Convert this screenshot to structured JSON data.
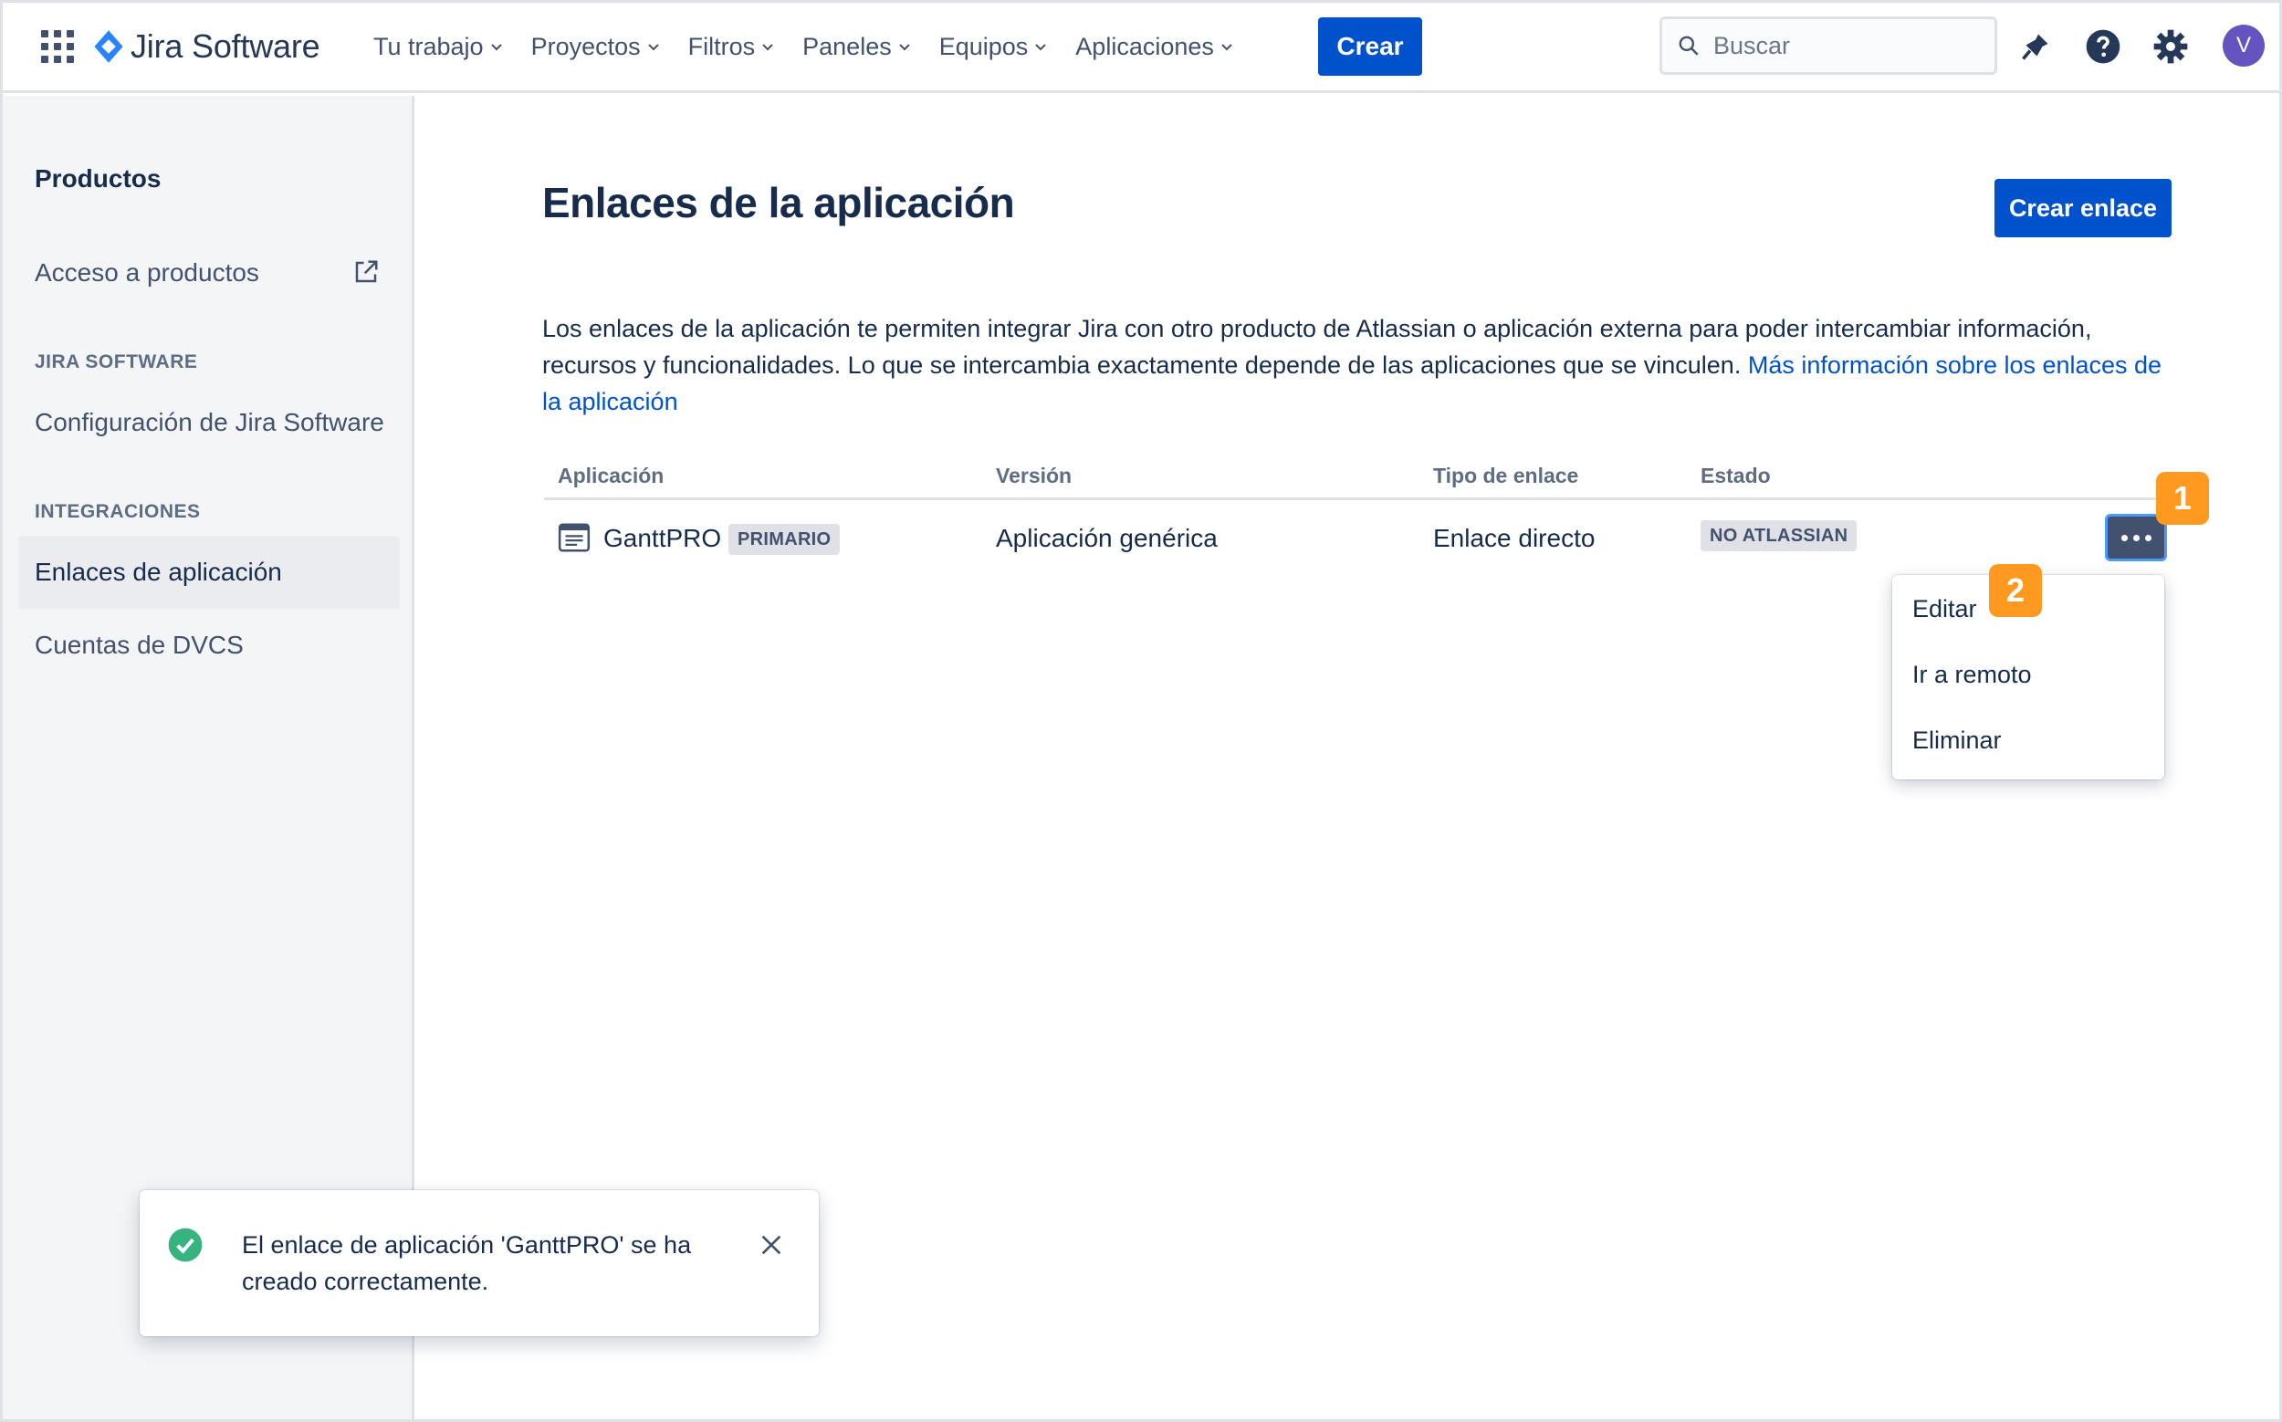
{
  "header": {
    "logo_text": "Jira Software",
    "nav": [
      {
        "label": "Tu trabajo"
      },
      {
        "label": "Proyectos"
      },
      {
        "label": "Filtros"
      },
      {
        "label": "Paneles"
      },
      {
        "label": "Equipos"
      },
      {
        "label": "Aplicaciones"
      }
    ],
    "create_label": "Crear",
    "search_placeholder": "Buscar",
    "avatar_initial": "V",
    "icons": [
      "app-switcher-icon",
      "notifications-icon",
      "help-icon",
      "settings-icon"
    ]
  },
  "sidebar": {
    "heading": "Productos",
    "product_access": "Acceso a productos",
    "section_jira": "JIRA SOFTWARE",
    "jira_config": "Configuración de Jira Software",
    "section_integrations": "INTEGRACIONES",
    "app_links": "Enlaces de aplicación",
    "dvcs_accounts": "Cuentas de DVCS"
  },
  "main": {
    "title": "Enlaces de la aplicación",
    "create_link_label": "Crear enlace",
    "description": "Los enlaces de la aplicación te permiten integrar Jira con otro producto de Atlassian o aplicación externa para poder intercambiar información, recursos y funcionalidades. Lo que se intercambia exactamente depende de las aplicaciones que se vinculen.",
    "description_link": "Más información sobre los enlaces de la aplicación",
    "table": {
      "headers": {
        "application": "Aplicación",
        "version": "Versión",
        "link_type": "Tipo de enlace",
        "status": "Estado"
      },
      "rows": [
        {
          "application": "GanttPRO",
          "badge": "PRIMARIO",
          "version": "Aplicación genérica",
          "link_type": "Enlace directo",
          "status": "NO ATLASSIAN"
        }
      ]
    },
    "actions_menu": [
      "Editar",
      "Ir a remoto",
      "Eliminar"
    ],
    "step_markers": [
      "1",
      "2"
    ]
  },
  "toast": {
    "message": "El enlace de aplicación 'GanttPRO' se ha creado correctamente."
  },
  "colors": {
    "primary": "#0052cc",
    "text": "#172b4d",
    "sidebar_bg": "#f4f5f7",
    "step_marker": "#ff991f",
    "success": "#36b37e"
  }
}
